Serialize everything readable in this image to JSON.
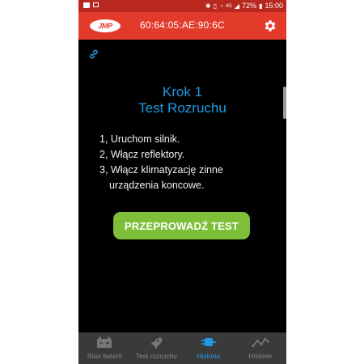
{
  "status_bar": {
    "battery_percent": "72%",
    "time": "15:00",
    "network": "4G",
    "icons": [
      "image-icon",
      "photo-icon",
      "bluetooth-icon",
      "vibrate-icon",
      "alarm-icon",
      "signal-icon",
      "battery-icon"
    ]
  },
  "header": {
    "logo_text": "JMP",
    "device_mac": "60:64:05:AE:90:6C",
    "settings_icon": "gear-icon",
    "bg_color": "#e23a2b"
  },
  "content": {
    "link_icon": "link-icon",
    "step_title": "Krok 1",
    "test_name": "Test Rozruchu",
    "instructions": [
      "1, Uruchom silnik.",
      "2, Włącz reflektory.",
      "3, Włącz klimatyzację zinne",
      "urządzenia koncowe."
    ],
    "run_button": "PRZEPROWADŹ TEST",
    "accent_color": "#1e9be3",
    "button_color": "#7ebf3a"
  },
  "bottom_nav": {
    "active_index": 2,
    "items": [
      {
        "label": "Stan baterii",
        "icon": "battery-icon"
      },
      {
        "label": "Test rozruchu",
        "icon": "rocket-icon"
      },
      {
        "label": "Historia",
        "icon": "plug-icon"
      },
      {
        "label": "Historie",
        "icon": "chart-line-icon"
      }
    ]
  }
}
